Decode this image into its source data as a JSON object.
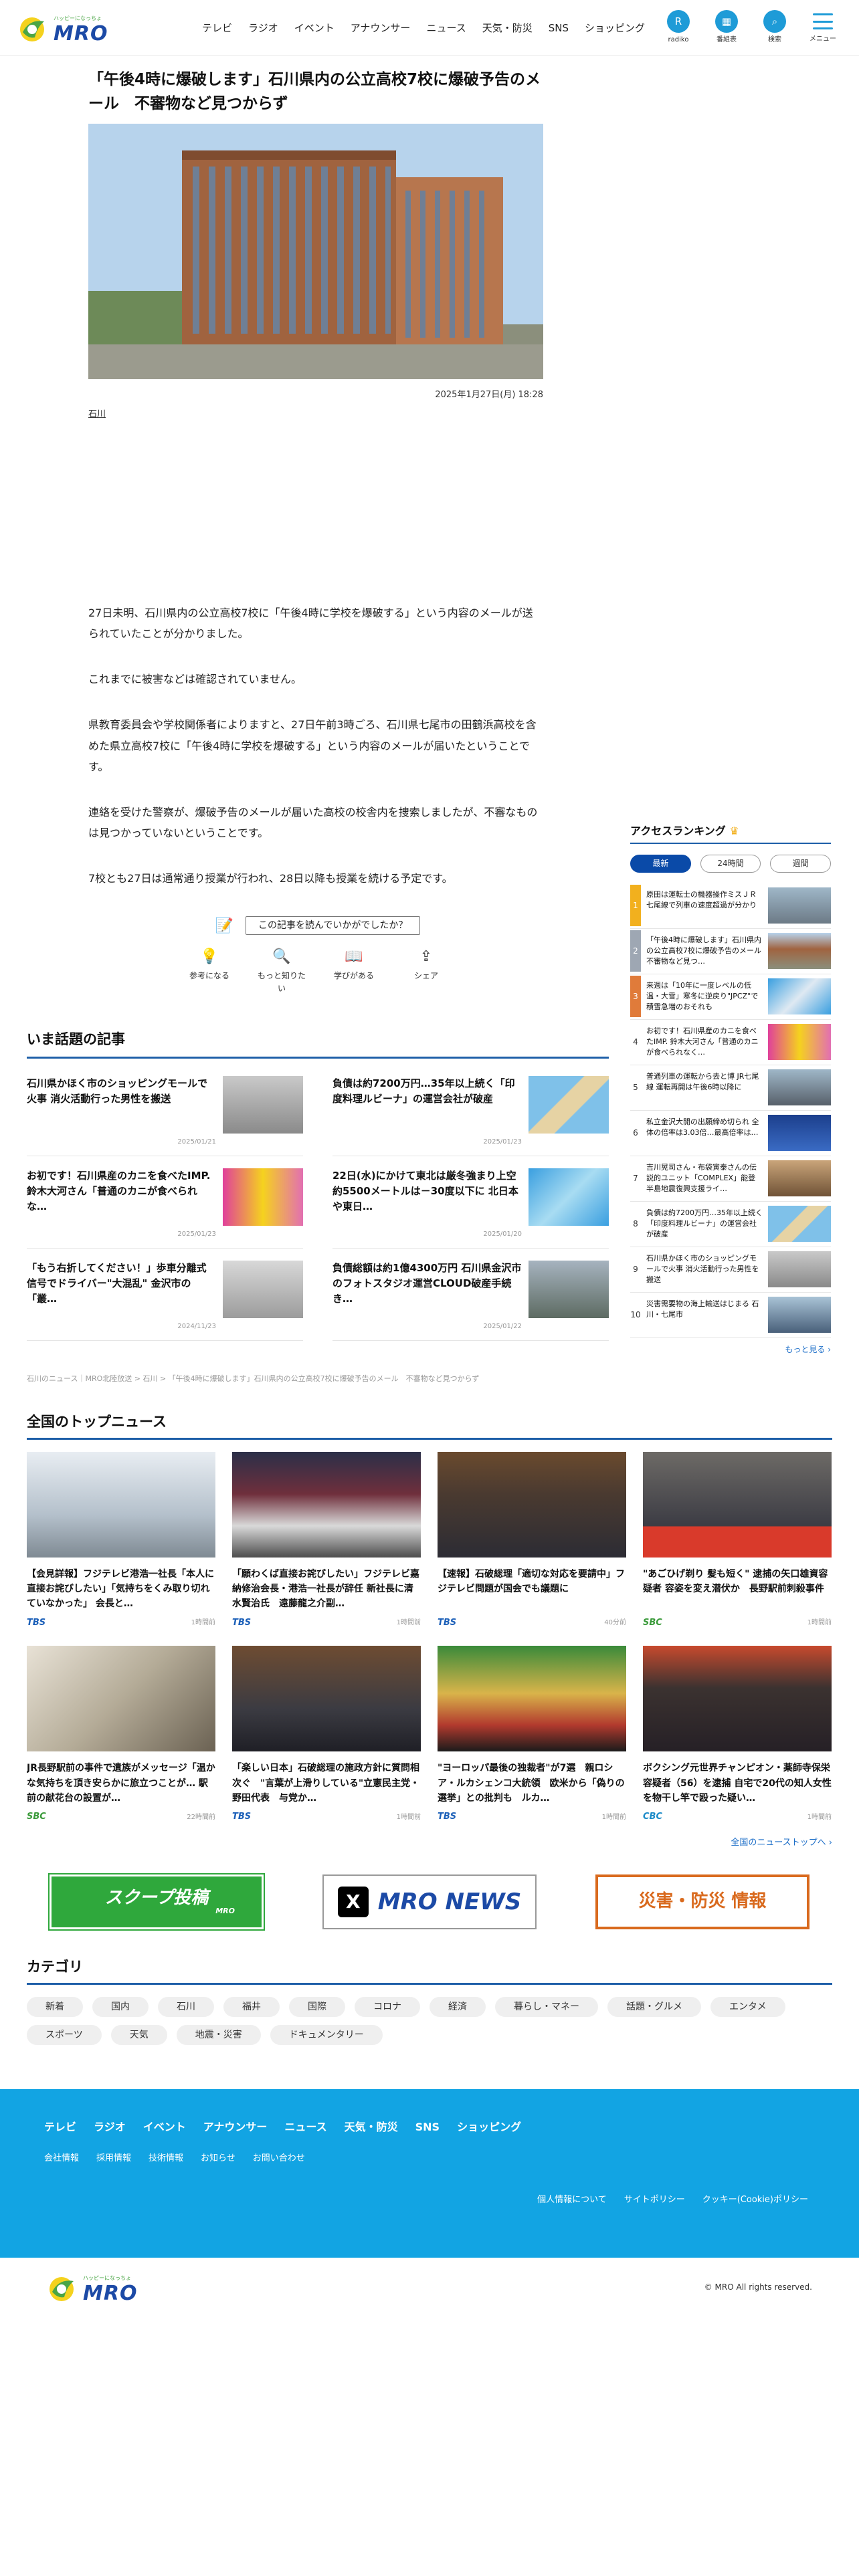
{
  "header": {
    "logo_text": "MRO",
    "logo_sub": "ハッピーになっちょ",
    "nav": [
      "テレビ",
      "ラジオ",
      "イベント",
      "アナウンサー",
      "ニュース",
      "天気・防災",
      "SNS",
      "ショッピング"
    ],
    "icons": [
      {
        "label": "radiko",
        "icon": "radiko-icon",
        "glyph": "R"
      },
      {
        "label": "番組表",
        "icon": "program-guide-icon",
        "glyph": "▦"
      },
      {
        "label": "検索",
        "icon": "search-icon",
        "glyph": "⌕"
      },
      {
        "label": "メニュー",
        "icon": "menu-icon",
        "glyph": ""
      }
    ]
  },
  "article": {
    "title": "「午後4時に爆破します」石川県内の公立高校7校に爆破予告のメール　不審物など見つからず",
    "date": "2025年1月27日(月) 18:28",
    "tag": "石川",
    "paragraphs": [
      "27日未明、石川県内の公立高校7校に「午後4時に学校を爆破する」という内容のメールが送られていたことが分かりました。",
      "これまでに被害などは確認されていません。",
      "県教育委員会や学校関係者によりますと、27日午前3時ごろ、石川県七尾市の田鶴浜高校を含めた県立高校7校に「午後4時に学校を爆破する」という内容のメールが届いたということです。",
      "連絡を受けた警察が、爆破予告のメールが届いた高校の校舎内を捜索しましたが、不審なものは見つかっていないということです。",
      "7校とも27日は通常通り授業が行われ、28日以降も授業を続ける予定です。"
    ],
    "question": "この記事を読んでいかがでしたか？",
    "reactions": [
      {
        "label": "参考になる",
        "icon": "lightbulb-icon",
        "glyph": "💡"
      },
      {
        "label": "もっと知りたい",
        "icon": "magnifier-icon",
        "glyph": "🔍"
      },
      {
        "label": "学びがある",
        "icon": "book-icon",
        "glyph": "📖"
      },
      {
        "label": "シェア",
        "icon": "share-icon",
        "glyph": "⇪"
      }
    ]
  },
  "wadai": {
    "title": "いま話題の記事",
    "items": [
      {
        "text": "石川県かほく市のショッピングモールで火事 消火活動行った男性を搬送",
        "date": "2025/01/21"
      },
      {
        "text": "負債は約7200万円…35年以上続く「印度料理ルビーナ」の運営会社が破産",
        "date": "2025/01/23"
      },
      {
        "text": "お初です！石川県産のカニを食べたIMP. 鈴木大河さん「普通のカニが食べられな…",
        "date": "2025/01/23"
      },
      {
        "text": "22日(水)にかけて東北は厳冬強まり上空約5500メートルは－30度以下に 北日本や東日…",
        "date": "2025/01/20"
      },
      {
        "text": "「もう右折してください！」歩車分離式信号でドライバー\"大混乱\" 金沢市の「叢…",
        "date": "2024/11/23"
      },
      {
        "text": "負債総額は約1億4300万円 石川県金沢市のフォトスタジオ運営CLOUD破産手続き…",
        "date": "2025/01/22"
      }
    ]
  },
  "breadcrumb": "石川のニュース｜MRO北陸放送 > 石川 > 「午後4時に爆破します」石川県内の公立高校7校に爆破予告のメール　不審物など見つからず",
  "topnews": {
    "title": "全国のトップニュース",
    "items": [
      {
        "caption": "【会見詳報】フジテレビ港浩一社長「本人に直接お詫びしたい」「気持ちをくみ取り切れていなかった」 会長と…",
        "source": "TBS",
        "time": "1時間前"
      },
      {
        "caption": "「願わくば直接お詫びしたい」フジテレビ嘉納修治会長・港浩一社長が辞任 新社長に清水賢治氏　遠藤龍之介副…",
        "source": "TBS",
        "time": "1時間前"
      },
      {
        "caption": "【速報】石破総理「適切な対応を要請中」フジテレビ問題が国会でも議題に",
        "source": "TBS",
        "time": "40分前"
      },
      {
        "caption": "\"あごひげ剃り 髪も短く\" 逮捕の矢口雄資容疑者 容姿を変え潜伏か　長野駅前刺殺事件",
        "source": "SBC",
        "time": "1時間前"
      },
      {
        "caption": "JR長野駅前の事件で遺族がメッセージ「温かな気持ちを頂き安らかに旅立つことが… 駅前の献花台の設置が…",
        "source": "SBC",
        "time": "22時間前"
      },
      {
        "caption": "「楽しい日本」石破総理の施政方針に質問相次ぐ　\"言葉が上滑りしている\"立憲民主党・野田代表　与党か…",
        "source": "TBS",
        "time": "1時間前"
      },
      {
        "caption": "\"ヨーロッパ最後の独裁者\"が7選　親ロシア・ルカシェンコ大統領　欧米から「偽りの選挙」との批判も　ルカ…",
        "source": "TBS",
        "time": "1時間前"
      },
      {
        "caption": "ボクシング元世界チャンピオン・薬師寺保栄容疑者（56）を逮捕 自宅で20代の知人女性を物干し竿で殴った疑い…",
        "source": "CBC",
        "time": "1時間前"
      }
    ],
    "more": "全国のニューストップへ ›"
  },
  "banners": [
    {
      "label": "スクープ投稿",
      "sub": "MRO",
      "icon": "scoop-banner"
    },
    {
      "label": "MRO NEWS",
      "sub": "X",
      "icon": "x-logo-icon"
    },
    {
      "label": "災害・防災 情報",
      "sub": "",
      "icon": "disaster-banner"
    }
  ],
  "categories": {
    "title": "カテゴリ",
    "items": [
      "新着",
      "国内",
      "石川",
      "福井",
      "国際",
      "コロナ",
      "経済",
      "暮らし・マネー",
      "話題・グルメ",
      "エンタメ",
      "スポーツ",
      "天気",
      "地震・災害",
      "ドキュメンタリー"
    ]
  },
  "footer": {
    "nav": [
      "テレビ",
      "ラジオ",
      "イベント",
      "アナウンサー",
      "ニュース",
      "天気・防災",
      "SNS",
      "ショッピング"
    ],
    "sub": [
      "会社情報",
      "採用情報",
      "技術情報",
      "お知らせ",
      "お問い合わせ"
    ],
    "legal": [
      "個人情報について",
      "サイトポリシー",
      "クッキー(Cookie)ポリシー"
    ],
    "copyright": "© MRO All rights reserved.",
    "bg": "#12a4e3"
  },
  "sidebar": {
    "title": "アクセスランキング",
    "tabs": [
      "最新",
      "24時間",
      "週間"
    ],
    "ranks": [
      {
        "num": "1",
        "text": "原田は運転士の機器操作ミスＪＲ七尾線で列車の速度超過が分かり",
        "color": "#f2b01e"
      },
      {
        "num": "2",
        "text": "「午後4時に爆破します」石川県内の公立高校7校に爆破予告のメール　不審物など見つ…",
        "color": "#9ea7b3"
      },
      {
        "num": "3",
        "text": "来週は「10年に一度レベルの低温・大雪」寒冬に逆戻り\"JPCZ\"で積雪急増のおそれも",
        "color": "#e07b3a"
      },
      {
        "num": "4",
        "text": "お初です！石川県産のカニを食べたIMP. 鈴木大河さん「普通のカニが食べられなく…",
        "color": ""
      },
      {
        "num": "5",
        "text": "普通列車の運転から去と博 JR七尾線 運転再開は午後6時以降に",
        "color": ""
      },
      {
        "num": "6",
        "text": "私立金沢大開の出願締め切られ 全体の倍率は3.03倍…最高倍率は…",
        "color": ""
      },
      {
        "num": "7",
        "text": "吉川晃司さん・布袋寅泰さんの伝説的ユニット「COMPLEX」能登半島地震復興支援ライ…",
        "color": ""
      },
      {
        "num": "8",
        "text": "負債は約7200万円…35年以上続く「印度料理ルビーナ」の運営会社が破産",
        "color": ""
      },
      {
        "num": "9",
        "text": "石川県かほく市のショッピングモールで火事 消火活動行った男性を搬送",
        "color": ""
      },
      {
        "num": "10",
        "text": "災害需要物の海上輸送はじまる 石川・七尾市",
        "color": ""
      }
    ],
    "more": "もっと見る ›"
  }
}
